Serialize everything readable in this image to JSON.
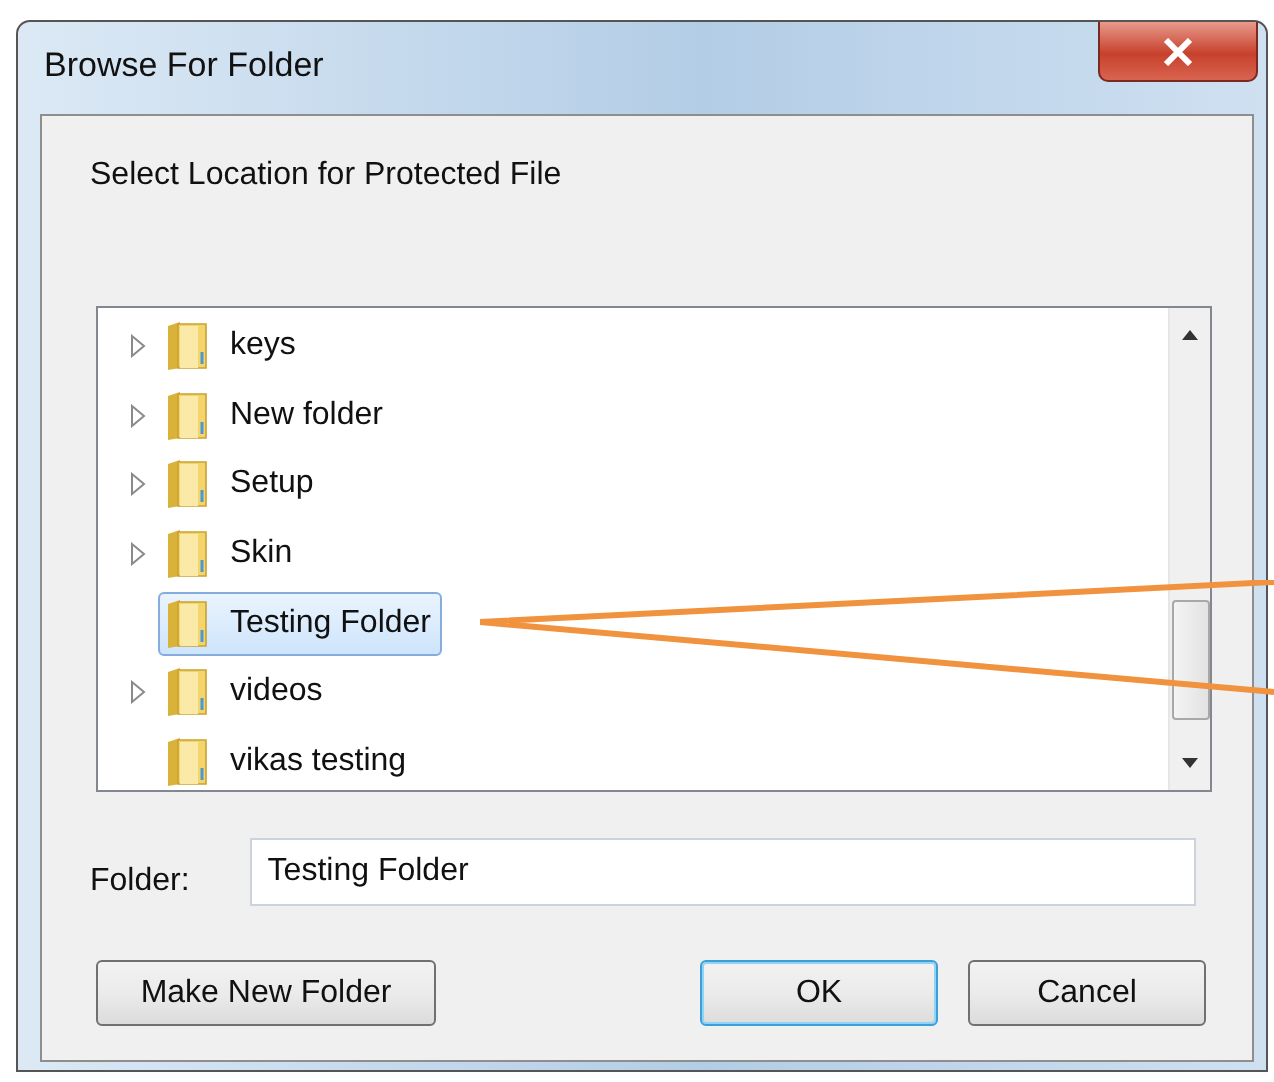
{
  "window": {
    "title": "Browse For Folder"
  },
  "prompt": "Select Location for Protected File",
  "tree": {
    "items": [
      {
        "label": "keys",
        "expandable": true,
        "selected": false
      },
      {
        "label": "New folder",
        "expandable": true,
        "selected": false
      },
      {
        "label": "Setup",
        "expandable": true,
        "selected": false
      },
      {
        "label": "Skin",
        "expandable": true,
        "selected": false
      },
      {
        "label": "Testing Folder",
        "expandable": false,
        "selected": true
      },
      {
        "label": "videos",
        "expandable": true,
        "selected": false
      },
      {
        "label": "vikas testing",
        "expandable": false,
        "selected": false
      }
    ]
  },
  "folder_field": {
    "label": "Folder:",
    "value": "Testing Folder"
  },
  "buttons": [
    {
      "label": "Make New Folder",
      "default": false
    },
    {
      "label": "OK",
      "default": true
    },
    {
      "label": "Cancel",
      "default": false
    }
  ]
}
